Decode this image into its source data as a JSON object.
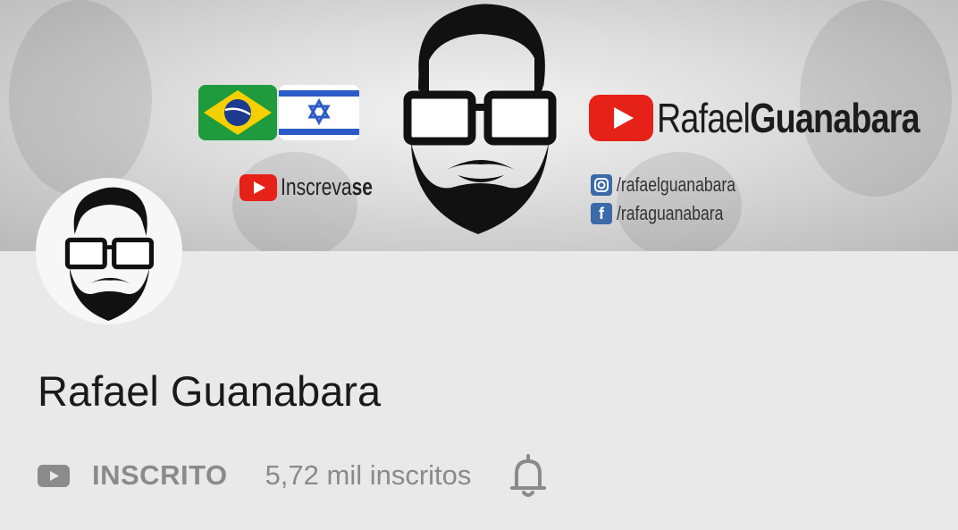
{
  "banner": {
    "brand_name_light": "Rafael",
    "brand_name_bold": "Guanabara",
    "subscribe_text_light": "Inscreva",
    "subscribe_text_bold": "se",
    "social": [
      {
        "network": "instagram-icon",
        "handle": "/rafaelguanabara"
      },
      {
        "network": "facebook-icon",
        "handle": "/rafaguanabara"
      }
    ],
    "flags": [
      "brazil-flag",
      "israel-flag"
    ]
  },
  "channel": {
    "name": "Rafael Guanabara",
    "subscribe_label": "INSCRITO",
    "subscriber_count": "5,72 mil inscritos"
  },
  "colors": {
    "youtube_red": "#e62117",
    "muted_text": "#8a8a8a",
    "page_bg": "#e9e9e9"
  }
}
